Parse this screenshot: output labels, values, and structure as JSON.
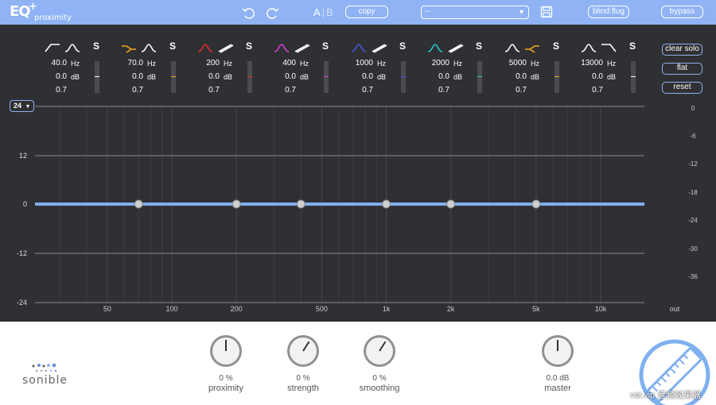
{
  "app": {
    "logo": "EQ",
    "plus": "+",
    "name": "proximity"
  },
  "toolbar": {
    "undo_icon": "undo-icon",
    "redo_icon": "redo-icon",
    "ab_a": "A",
    "ab_sep": "|",
    "ab_b": "B",
    "copy_label": "copy",
    "preset_value": "--",
    "save_icon": "save-icon",
    "blind_label": "blind:flug",
    "bypass_label": "bypass"
  },
  "bands": [
    {
      "shape": "highpass-icon",
      "shape2": "bell-icon",
      "color": "#ffffff",
      "freq": "40.0",
      "gain": "0.0",
      "q": "0.7"
    },
    {
      "shape": "low-shelf-icon",
      "shape2": "bell-icon",
      "color": "#f4a81d",
      "freq": "70.0",
      "gain": "0.0",
      "q": "0.7"
    },
    {
      "shape": "bell-icon",
      "shape2": "proximity-icon",
      "color": "#e0322c",
      "freq": "200",
      "gain": "0.0",
      "q": "0.7"
    },
    {
      "shape": "bell-icon",
      "shape2": "proximity-icon",
      "color": "#d63fd6",
      "freq": "400",
      "gain": "0.0",
      "q": "0.7"
    },
    {
      "shape": "bell-icon",
      "shape2": "proximity-icon",
      "color": "#4a55e0",
      "freq": "1000",
      "gain": "0.0",
      "q": "0.7"
    },
    {
      "shape": "bell-icon",
      "shape2": "proximity-icon",
      "color": "#27c9c9",
      "freq": "2000",
      "gain": "0.0",
      "q": "0.7"
    },
    {
      "shape": "bell-icon",
      "shape2": "high-shelf-icon",
      "color": "#f4a81d",
      "freq": "5000",
      "gain": "0.0",
      "q": "0.7"
    },
    {
      "shape": "bell-icon",
      "shape2": "lowpass-icon",
      "color": "#ffffff",
      "freq": "13000",
      "gain": "0.0",
      "q": "0.7"
    }
  ],
  "band_units": {
    "freq": "Hz",
    "gain": "dB",
    "solo": "S"
  },
  "side_buttons": {
    "clear_solo": "clear solo",
    "flat": "flat",
    "reset": "reset"
  },
  "range": {
    "value": "24",
    "arrow": "▼"
  },
  "graph": {
    "y_labels": [
      "12",
      "0",
      "-12",
      "-24"
    ],
    "out_labels": [
      "0",
      "-6",
      "-12",
      "-18",
      "-24",
      "-30",
      "-36"
    ],
    "x_labels": [
      "50",
      "100",
      "200",
      "500",
      "1k",
      "2k",
      "5k",
      "10k",
      "out"
    ],
    "node_freqs": [
      70,
      200,
      400,
      1000,
      2000,
      5000
    ],
    "curve_color": "#7fb0f0"
  },
  "knobs": [
    {
      "value": "0 %",
      "label": "proximity",
      "level": 0.5
    },
    {
      "value": "0 %",
      "label": "strength",
      "level": 0.62
    },
    {
      "value": "0 %",
      "label": "smoothing",
      "level": 0.62
    },
    {
      "value": "0.0 dB",
      "label": "master",
      "level": 0.5
    }
  ],
  "brand": {
    "name": "sonible"
  },
  "meter_icon": "ruler-meter-icon",
  "watermark": "vst.vip 音频效果器"
}
